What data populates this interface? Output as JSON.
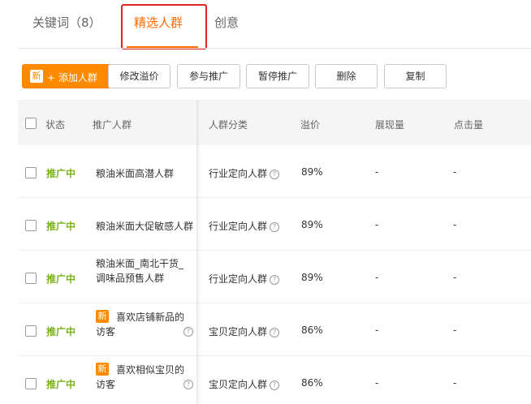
{
  "tabs": [
    {
      "label": "关键词（8）"
    },
    {
      "label": "精选人群"
    },
    {
      "label": "创意"
    }
  ],
  "toolbar": {
    "add_badge": "新",
    "add_label": "+ 添加人群",
    "buttons": [
      "修改溢价",
      "参与推广",
      "暂停推广",
      "删除",
      "复制"
    ]
  },
  "table": {
    "headers": {
      "status": "状态",
      "crowd": "推广人群",
      "category": "人群分类",
      "premium": "溢价",
      "impressions": "展现量",
      "clicks": "点击量"
    },
    "rows": [
      {
        "status": "推广中",
        "crowd": "粮油米面高潜人群",
        "category": "行业定向人群",
        "premium": "89%",
        "impressions": "-",
        "clicks": "-"
      },
      {
        "status": "推广中",
        "crowd": "粮油米面大促敏感人群",
        "category": "行业定向人群",
        "premium": "89%",
        "impressions": "-",
        "clicks": "-"
      },
      {
        "status": "推广中",
        "crowd_line1": "粮油米面_南北干货_",
        "crowd_line2": "调味品预售人群",
        "category": "行业定向人群",
        "premium": "89%",
        "impressions": "-",
        "clicks": "-"
      },
      {
        "status": "推广中",
        "badge": "新",
        "crowd_line1": "喜欢店铺新品的",
        "crowd_line2": "访客",
        "category": "宝贝定向人群",
        "premium": "86%",
        "impressions": "-",
        "clicks": "-"
      },
      {
        "status": "推广中",
        "badge": "新",
        "crowd_line1": "喜欢相似宝贝的",
        "crowd_line2": "访客",
        "category": "宝贝定向人群",
        "premium": "86%",
        "impressions": "-",
        "clicks": "-"
      }
    ]
  },
  "icons": {
    "help": "?"
  },
  "colors": {
    "accent": "#ff6a00",
    "primary_button": "#ff8a00",
    "status_active": "#7ab317",
    "highlight_box": "#e8221f"
  }
}
